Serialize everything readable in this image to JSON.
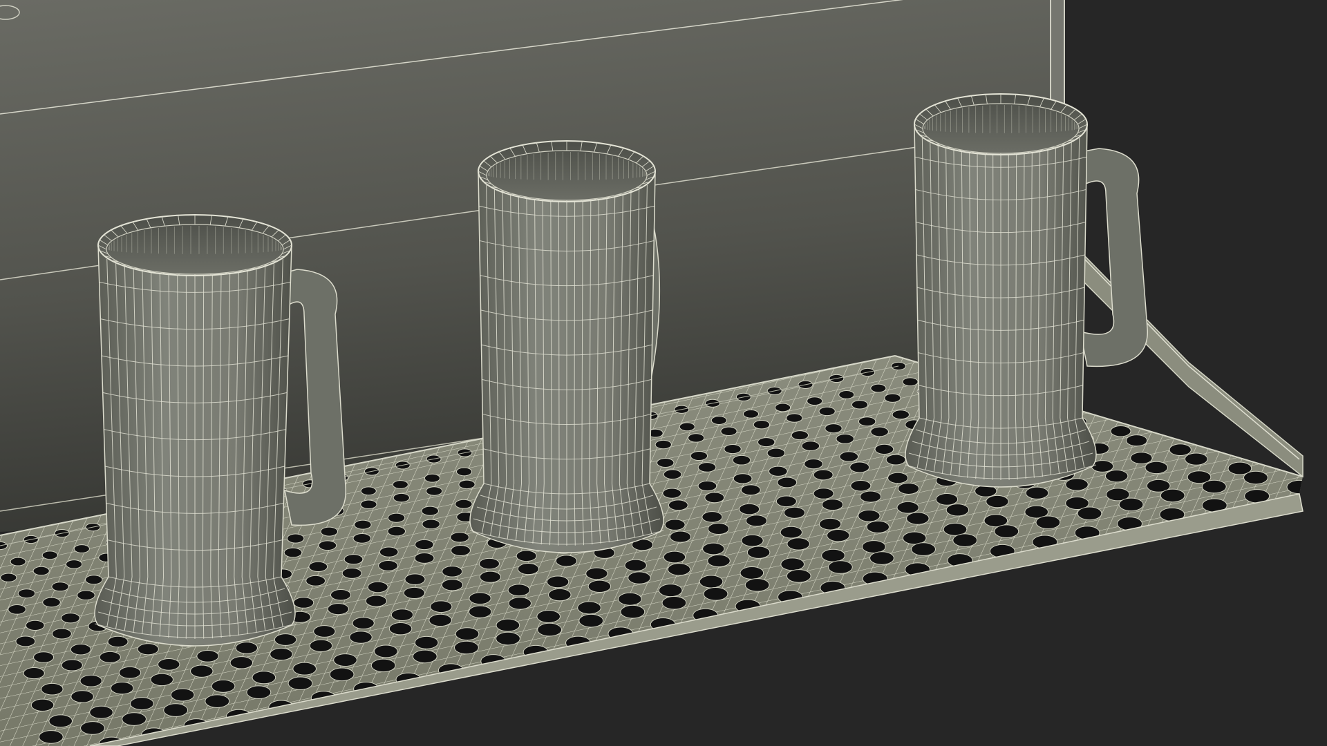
{
  "scene": {
    "subject": "wireframe-render",
    "objects": [
      "back-panel",
      "drip-tray",
      "beer-mug",
      "beer-mug",
      "beer-mug"
    ]
  },
  "colors": {
    "background": "#262626",
    "panel_light": "#656660",
    "panel_dark": "#3b3c38",
    "mesh_base": "#777a70",
    "mesh_shadow": "#4a4c45",
    "wire": "#dcdccf",
    "hole": "#111111",
    "tray_top": "#858777"
  }
}
